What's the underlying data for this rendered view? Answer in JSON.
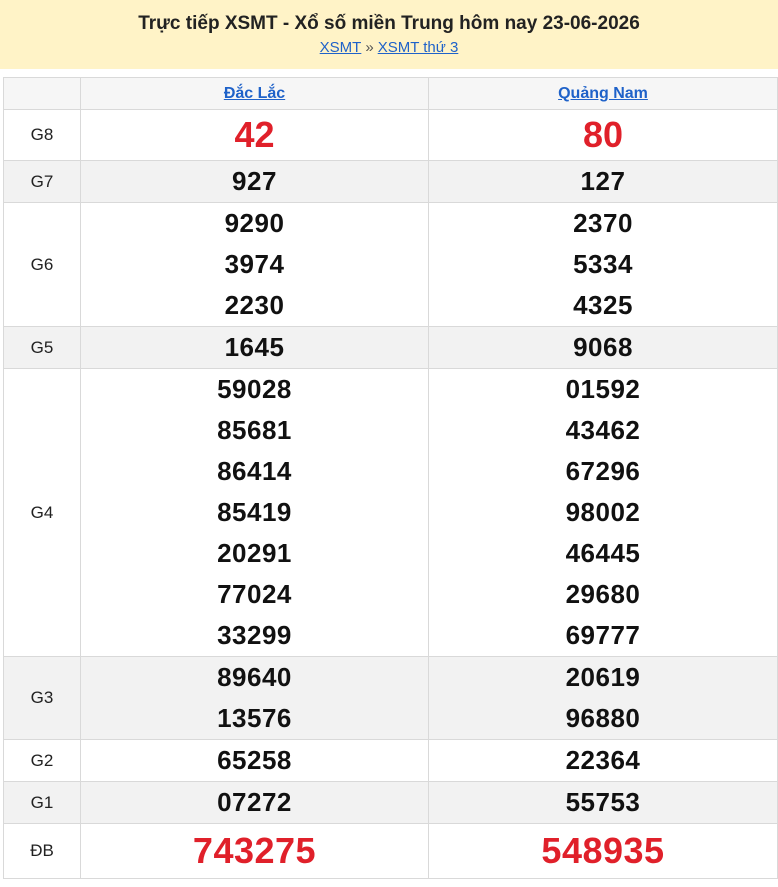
{
  "header": {
    "title": "Trực tiếp XSMT - Xổ số miền Trung hôm nay 23-06-2026",
    "crumb_1": "XSMT",
    "crumb_sep": "»",
    "crumb_2": "XSMT thứ 3"
  },
  "table": {
    "provinces": [
      "Đắc Lắc",
      "Quảng Nam"
    ],
    "rows": [
      {
        "label": "G8",
        "values": [
          [
            "42"
          ],
          [
            "80"
          ]
        ]
      },
      {
        "label": "G7",
        "values": [
          [
            "927"
          ],
          [
            "127"
          ]
        ]
      },
      {
        "label": "G6",
        "values": [
          [
            "9290",
            "3974",
            "2230"
          ],
          [
            "2370",
            "5334",
            "4325"
          ]
        ]
      },
      {
        "label": "G5",
        "values": [
          [
            "1645"
          ],
          [
            "9068"
          ]
        ]
      },
      {
        "label": "G4",
        "values": [
          [
            "59028",
            "85681",
            "86414",
            "85419",
            "20291",
            "77024",
            "33299"
          ],
          [
            "01592",
            "43462",
            "67296",
            "98002",
            "46445",
            "29680",
            "69777"
          ]
        ]
      },
      {
        "label": "G3",
        "values": [
          [
            "89640",
            "13576"
          ],
          [
            "20619",
            "96880"
          ]
        ]
      },
      {
        "label": "G2",
        "values": [
          [
            "65258"
          ],
          [
            "22364"
          ]
        ]
      },
      {
        "label": "G1",
        "values": [
          [
            "07272"
          ],
          [
            "55753"
          ]
        ]
      },
      {
        "label": "ĐB",
        "values": [
          [
            "743275"
          ],
          [
            "548935"
          ]
        ]
      }
    ]
  },
  "colors": {
    "header_bg": "#fff3c7",
    "link": "#1f62c9",
    "accent_red": "#e0202a",
    "alt_row": "#f2f2f2"
  }
}
